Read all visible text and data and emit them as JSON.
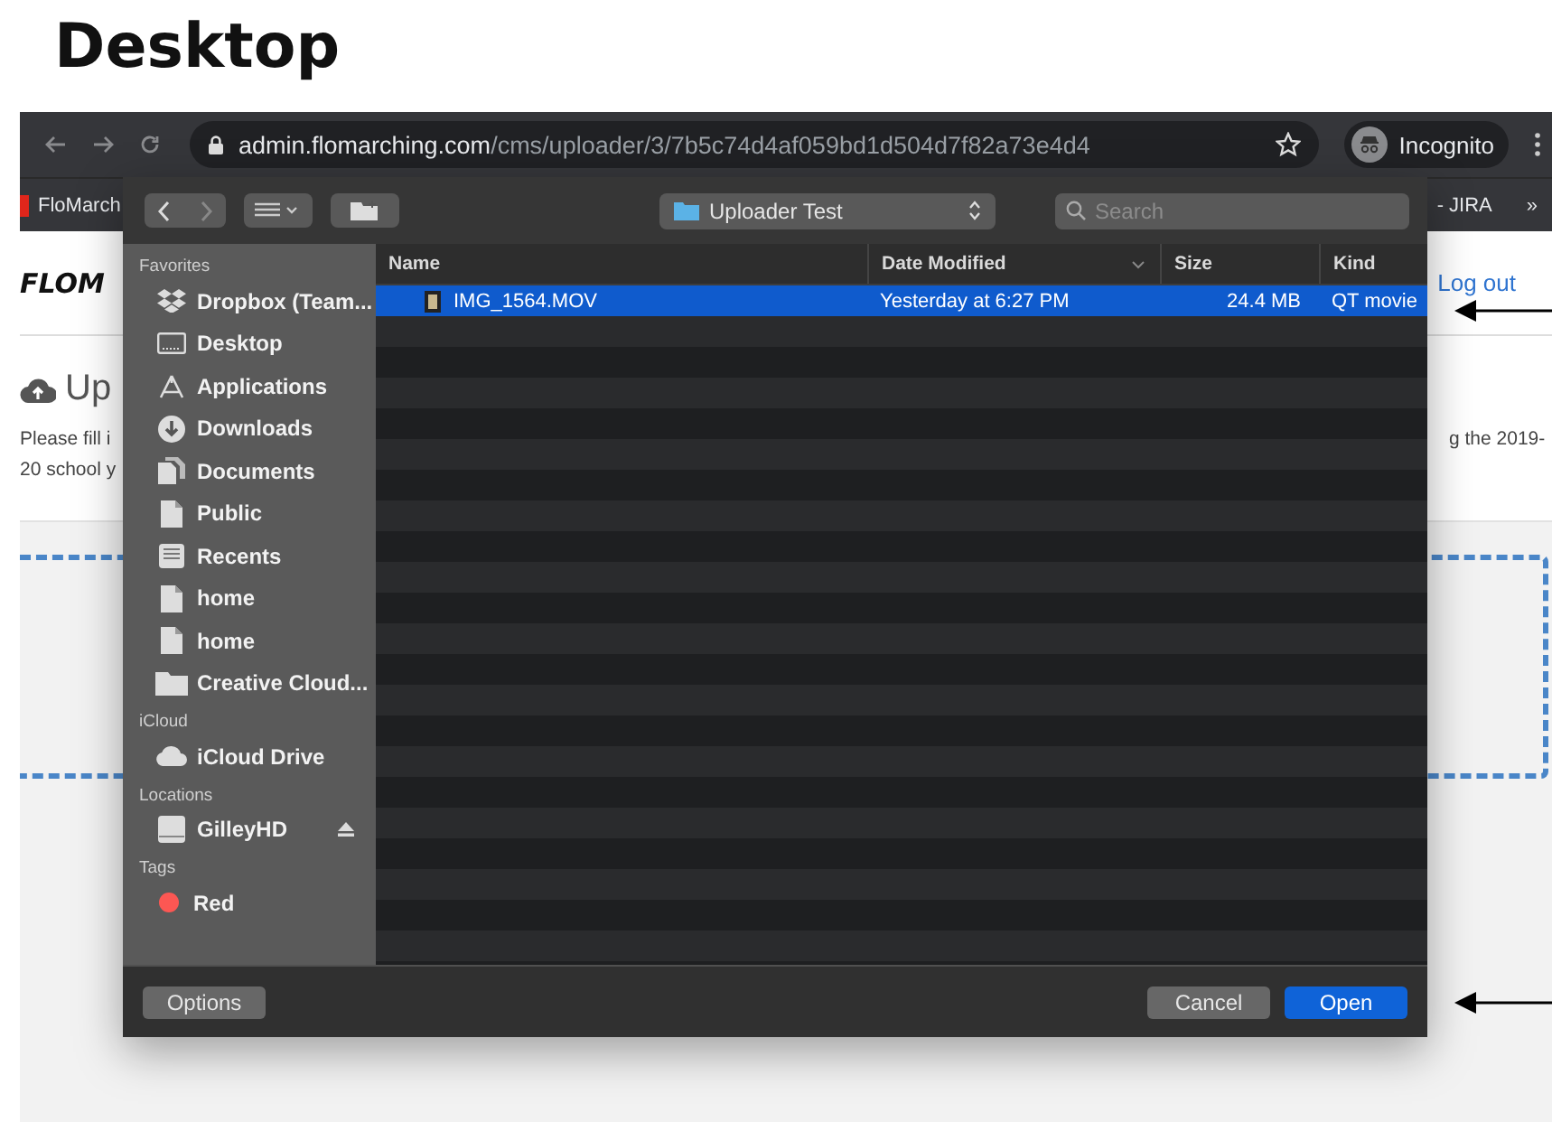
{
  "heading": "Desktop",
  "browser": {
    "url_host": "admin.flomarching.com",
    "url_path": "/cms/uploader/3/7b5c74d4af059bd1d504d7f82a73e4d4",
    "profile": "Incognito",
    "bookmarks": [
      "FloMarch",
      "- JIRA"
    ],
    "bookmarks_overflow": "»"
  },
  "page": {
    "logo": "FLOM",
    "logout": "Log out",
    "title": "Up",
    "intro_left": [
      "Please fill i",
      "20 school y"
    ],
    "intro_right": "g the 2019-"
  },
  "dialog": {
    "location": "Uploader Test",
    "search_placeholder": "Search",
    "sidebar": [
      {
        "heading": "Favorites",
        "items": [
          {
            "label": "Dropbox (Team...",
            "kind": "dropbox"
          },
          {
            "label": "Desktop",
            "kind": "desktop"
          },
          {
            "label": "Applications",
            "kind": "apps"
          },
          {
            "label": "Downloads",
            "kind": "download"
          },
          {
            "label": "Documents",
            "kind": "docs"
          },
          {
            "label": "Public",
            "kind": "file"
          },
          {
            "label": "Recents",
            "kind": "recents"
          },
          {
            "label": "home",
            "kind": "file"
          },
          {
            "label": "home",
            "kind": "file"
          },
          {
            "label": "Creative Cloud...",
            "kind": "folder"
          }
        ]
      },
      {
        "heading": "iCloud",
        "items": [
          {
            "label": "iCloud Drive",
            "kind": "cloud"
          }
        ]
      },
      {
        "heading": "Locations",
        "items": [
          {
            "label": "GilleyHD",
            "kind": "disk",
            "eject": true
          }
        ]
      },
      {
        "heading": "Tags",
        "items": [
          {
            "label": "Red",
            "kind": "tag",
            "color": "#fc5753"
          }
        ]
      }
    ],
    "columns": [
      "Name",
      "Date Modified",
      "Size",
      "Kind"
    ],
    "files": [
      {
        "name": "IMG_1564.MOV",
        "date": "Yesterday at 6:27 PM",
        "size": "24.4 MB",
        "kind": "QT movie",
        "selected": true
      }
    ],
    "options": "Options",
    "cancel": "Cancel",
    "open": "Open"
  }
}
